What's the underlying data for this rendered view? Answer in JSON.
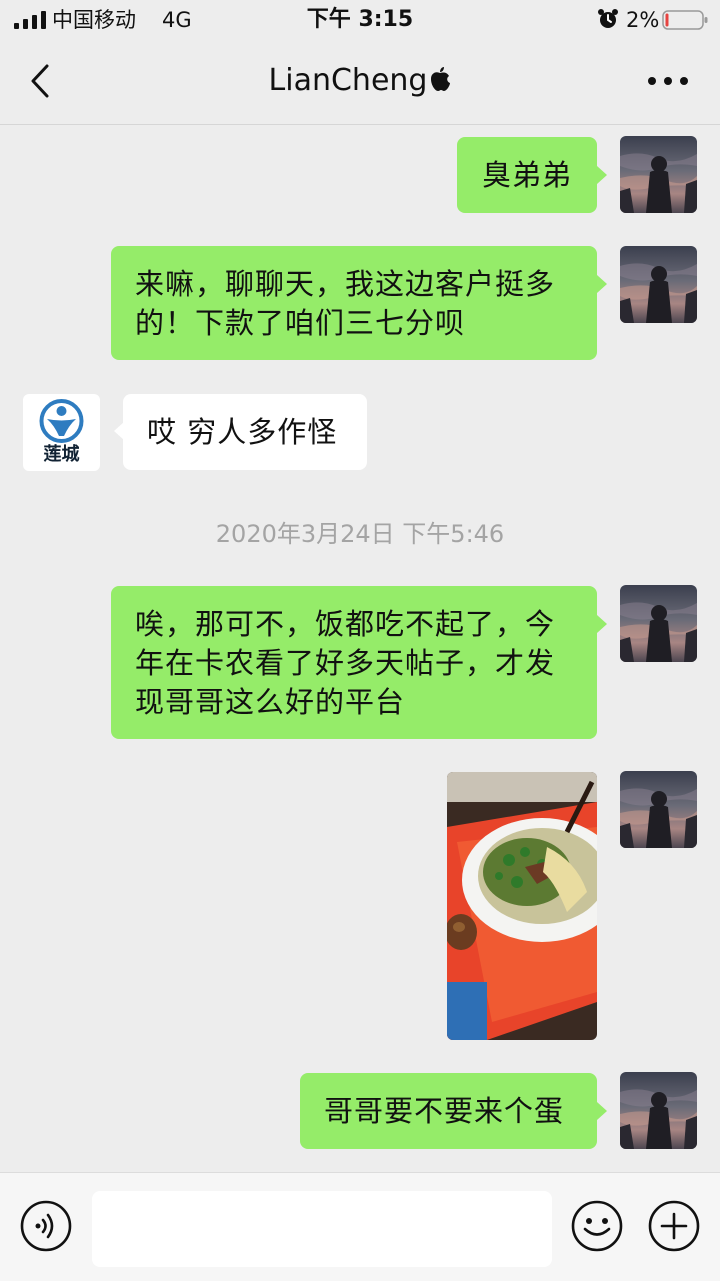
{
  "status_bar": {
    "carrier": "中国移动",
    "network": "4G",
    "time": "下午 3:15",
    "battery_percent": "2%",
    "battery_level": 0.02,
    "icons": [
      "signal-icon",
      "alarm-icon",
      "battery-icon"
    ]
  },
  "header": {
    "title": "LianCheng",
    "icons": [
      "back-icon",
      "apple-icon",
      "more-icon"
    ]
  },
  "messages": [
    {
      "sender": "me",
      "text": "臭弟弟"
    },
    {
      "sender": "me",
      "lines": [
        "来嘛，聊聊天，我这边客户挺多",
        "的！下款了咱们三七分呗"
      ]
    },
    {
      "sender": "other",
      "text": "哎 穷人多作怪",
      "avatar_label": "莲城"
    },
    {
      "type": "timestamp",
      "text": "2020年3月24日 下午5:46"
    },
    {
      "sender": "me",
      "lines": [
        "唉，那可不，饭都吃不起了，今",
        "年在卡农看了好多天帖子，才发",
        "现哥哥这么好的平台"
      ]
    },
    {
      "sender": "me",
      "type": "image"
    },
    {
      "sender": "me",
      "text": "哥哥要不要来个蛋"
    }
  ],
  "input_bar": {
    "placeholder": "",
    "icons": [
      "voice-icon",
      "emoji-icon",
      "plus-icon"
    ]
  },
  "colors": {
    "background": "#ededed",
    "my_bubble": "#95ec69",
    "other_bubble": "#ffffff",
    "timestamp": "#a4a4a4",
    "battery_low": "#e64340",
    "logo_blue": "#2e7cc0"
  }
}
